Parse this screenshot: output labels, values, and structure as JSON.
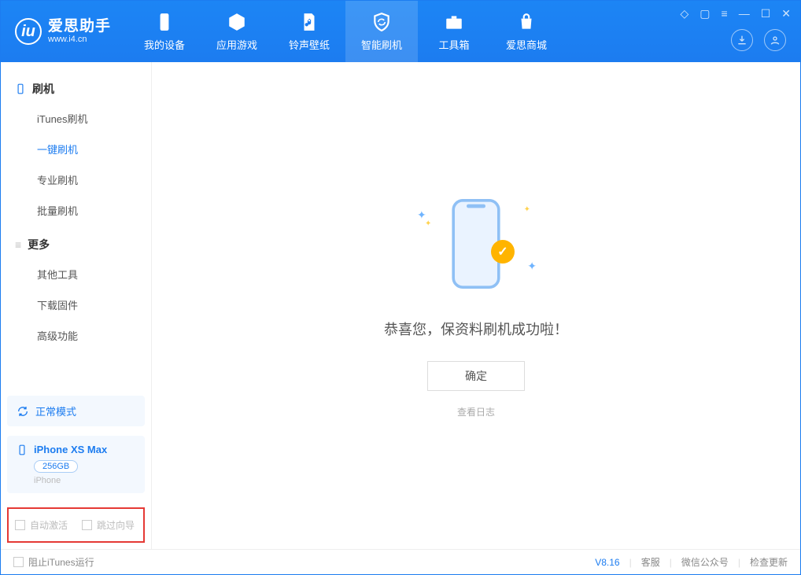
{
  "brand": {
    "name": "爱思助手",
    "url": "www.i4.cn"
  },
  "nav": {
    "device": "我的设备",
    "apps": "应用游戏",
    "ring": "铃声壁纸",
    "flash": "智能刷机",
    "toolbox": "工具箱",
    "store": "爱思商城"
  },
  "sidebar": {
    "cat_flash": "刷机",
    "itunes": "iTunes刷机",
    "oneclick": "一键刷机",
    "pro": "专业刷机",
    "batch": "批量刷机",
    "cat_more": "更多",
    "other": "其他工具",
    "firmware": "下载固件",
    "advanced": "高级功能"
  },
  "mode": {
    "label": "正常模式"
  },
  "device": {
    "name": "iPhone XS Max",
    "storage": "256GB",
    "type": "iPhone"
  },
  "options": {
    "auto_activate": "自动激活",
    "skip_guide": "跳过向导"
  },
  "main": {
    "success": "恭喜您，保资料刷机成功啦！",
    "ok": "确定",
    "view_log": "查看日志"
  },
  "footer": {
    "block_itunes": "阻止iTunes运行",
    "version": "V8.16",
    "support": "客服",
    "wechat": "微信公众号",
    "update": "检查更新"
  }
}
